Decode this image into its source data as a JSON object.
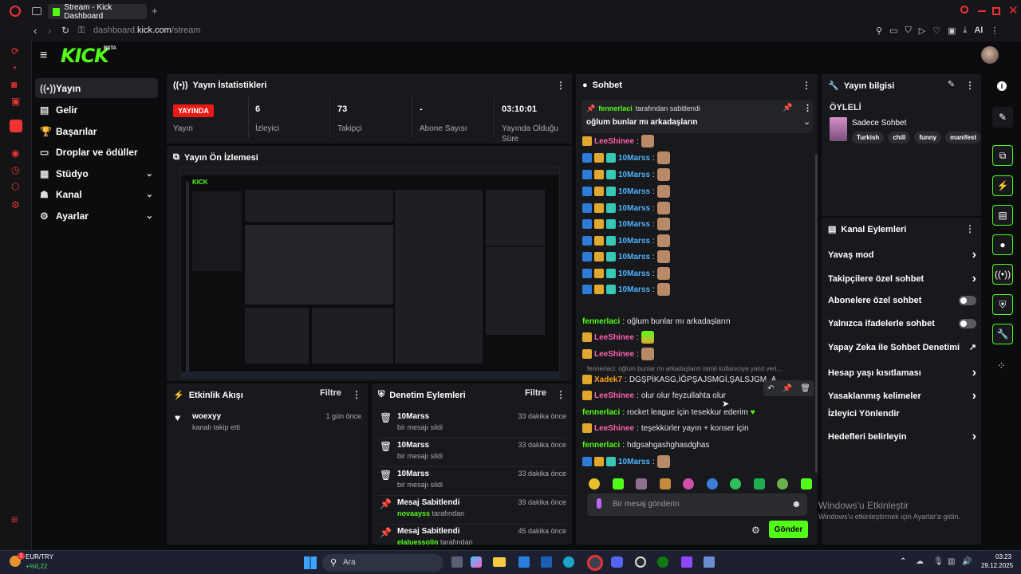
{
  "browser": {
    "tab_title": "Stream - Kick Dashboard",
    "url_gray": "dashboard.",
    "url_white": "kick.com",
    "url_path": "/stream",
    "ai_label": "AI"
  },
  "header": {
    "logo": "KICK",
    "beta": "BETA"
  },
  "nav": [
    {
      "label": "Yayın",
      "icon": "broadcast-icon"
    },
    {
      "label": "Gelir",
      "icon": "wallet-icon"
    },
    {
      "label": "Başarılar",
      "icon": "trophy-icon"
    },
    {
      "label": "Droplar ve ödüller",
      "icon": "gift-icon"
    },
    {
      "label": "Stüdyo",
      "icon": "grid-icon"
    },
    {
      "label": "Kanal",
      "icon": "user-icon"
    },
    {
      "label": "Ayarlar",
      "icon": "gear-icon"
    }
  ],
  "stats": {
    "title": "Yayın İstatistikleri",
    "live_badge": "YAYINDA",
    "items": [
      {
        "value": "",
        "label": "Yayın"
      },
      {
        "value": "6",
        "label": "İzleyici"
      },
      {
        "value": "73",
        "label": "Takipçi"
      },
      {
        "value": "-",
        "label": "Abone Sayısı"
      },
      {
        "value": "03:10:01",
        "label": "Yayında Olduğu Süre"
      }
    ]
  },
  "preview": {
    "title": "Yayın Ön İzlemesi"
  },
  "feed": {
    "title": "Etkinlik Akışı",
    "filter": "Filtre",
    "items": [
      {
        "title": "woexyy",
        "sub": "kanalı takip etti",
        "time": "1 gün önce"
      }
    ]
  },
  "mod": {
    "title": "Denetim Eylemleri",
    "filter": "Filtre",
    "items": [
      {
        "title": "10Marss",
        "sub": "bir mesajı sildi",
        "time": "33 dakika önce",
        "icon": "trash-icon"
      },
      {
        "title": "10Marss",
        "sub": "bir mesajı sildi",
        "time": "33 dakika önce",
        "icon": "trash-icon"
      },
      {
        "title": "10Marss",
        "sub": "bir mesajı sildi",
        "time": "33 dakika önce",
        "icon": "trash-icon"
      },
      {
        "title": "Mesaj Sabitlendi",
        "sub_user": "novaayss",
        "sub": "tarafından",
        "time": "39 dakika önce",
        "icon": "pin-icon"
      },
      {
        "title": "Mesaj Sabitlendi",
        "sub_user": "elaluessolin",
        "sub": "tarafından",
        "time": "45 dakika önce",
        "icon": "pin-icon"
      }
    ]
  },
  "chat": {
    "title": "Sohbet",
    "pinned_by_user": "fennerlaci",
    "pinned_by_text": "tarafından sabitlendi",
    "pinned_msg": "oğlum bunlar mı arkadaşların",
    "messages": [
      {
        "user": "LeeShinee",
        "color": "#ff5fb0",
        "text": "",
        "emote": true
      },
      {
        "user": "10Marss",
        "color": "#4fb3ff",
        "text": "",
        "emote": true
      },
      {
        "user": "10Marss",
        "color": "#4fb3ff",
        "text": "",
        "emote": true
      },
      {
        "user": "10Marss",
        "color": "#4fb3ff",
        "text": "",
        "emote": true
      },
      {
        "user": "10Marss",
        "color": "#4fb3ff",
        "text": "",
        "emote": true
      },
      {
        "user": "10Marss",
        "color": "#4fb3ff",
        "text": "",
        "emote": true
      },
      {
        "user": "10Marss",
        "color": "#4fb3ff",
        "text": "",
        "emote": true
      },
      {
        "user": "10Marss",
        "color": "#4fb3ff",
        "text": "",
        "emote": true
      },
      {
        "user": "10Marss",
        "color": "#4fb3ff",
        "text": "",
        "emote": true
      },
      {
        "user": "10Marss",
        "color": "#4fb3ff",
        "text": "",
        "emote": true
      },
      {
        "user": "fennerlaci",
        "color": "#53fc18",
        "text": "oğlum bunlar mı arkadaşların",
        "emote": false
      },
      {
        "user": "LeeShinee",
        "color": "#ff5fb0",
        "text": "",
        "emote": true
      },
      {
        "user": "LeeShinee",
        "color": "#ff5fb0",
        "text": "",
        "emote": true
      },
      {
        "user": "Xadek7",
        "color": "#ff9f1a",
        "text": "DGŞPİKASG,İĞPŞAJSMGİ,ŞALSJGM,,A",
        "emote": false
      },
      {
        "user": "LeeShinee",
        "color": "#ff5fb0",
        "text": "olur olur feyzullahta olur",
        "emote": false
      },
      {
        "user": "fennerlaci",
        "color": "#53fc18",
        "text": "rocket league için tesekkur ederim",
        "emote": false
      },
      {
        "user": "LeeShinee",
        "color": "#ff5fb0",
        "text": "teşekkürler yayın + konser için",
        "emote": false
      },
      {
        "user": "fennerlaci",
        "color": "#53fc18",
        "text": "hdgsahgashghasdghas",
        "emote": false
      },
      {
        "user": "10Marss",
        "color": "#4fb3ff",
        "text": "",
        "emote": true
      }
    ],
    "reply_hint": "fennerlaci: oğlum bunlar mı arkadaşların isimli kullanıcıya yanıt veri...",
    "input_placeholder": "Bir mesaj gönderin",
    "send": "Gönder"
  },
  "info": {
    "title": "Yayın bilgisi",
    "time_label": "ÖYLELİ",
    "category": "Sadece Sohbet",
    "tags": [
      "Turkish",
      "chill",
      "funny",
      "manifest"
    ]
  },
  "channel_actions": {
    "title": "Kanal Eylemleri",
    "items": [
      {
        "label": "Yavaş mod",
        "ctrl": "chevron"
      },
      {
        "label": "Takipçilere özel sohbet",
        "ctrl": "chevron"
      },
      {
        "label": "Abonelere özel sohbet",
        "ctrl": "toggle"
      },
      {
        "label": "Yalnızca ifadelerle sohbet",
        "ctrl": "toggle"
      },
      {
        "label": "Yapay Zeka ile Sohbet Denetimi",
        "ctrl": "external"
      },
      {
        "label": "Hesap yaşı kısıtlaması",
        "ctrl": "chevron"
      },
      {
        "label": "Yasaklanmış kelimeler",
        "ctrl": "chevron"
      },
      {
        "label": "İzleyici Yönlendir",
        "ctrl": "none"
      },
      {
        "label": "Hedefleri belirleyin",
        "ctrl": "chevron"
      }
    ]
  },
  "windows": {
    "watermark1": "Windows'u Etkinleştir",
    "watermark2": "Windows'u etkinleştirmek için Ayarlar'a gidin.",
    "ticker": "EUR/TRY",
    "ticker_change": "+%0,22",
    "ticker_badge": "1",
    "search": "Ara",
    "time": "03:23",
    "date": "29.12.2025"
  },
  "colors": {
    "kick_green": "#53fc18",
    "live_red": "#e91916",
    "panel": "#18191c",
    "bg": "#0b0c0e"
  }
}
